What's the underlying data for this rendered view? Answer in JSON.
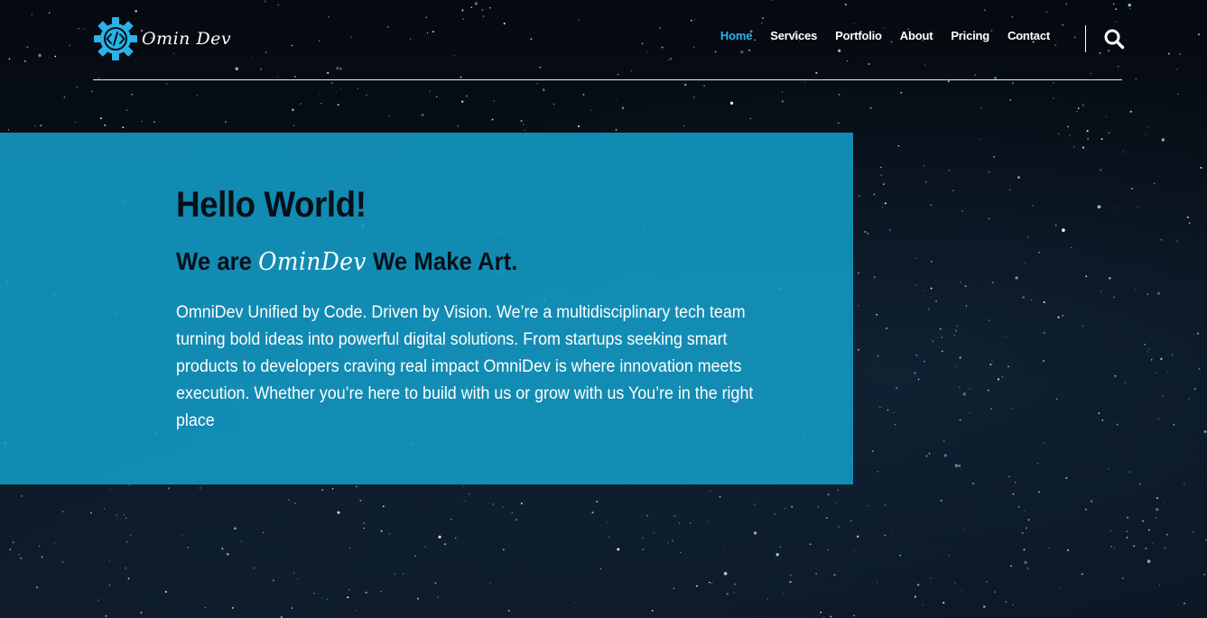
{
  "brand": {
    "logo_text": "Omin Dev",
    "logo_icon": "gear-code-icon",
    "accent_color": "#29b3e8"
  },
  "nav": {
    "items": [
      {
        "label": "Home",
        "active": true
      },
      {
        "label": "Services",
        "active": false
      },
      {
        "label": "Portfolio",
        "active": false
      },
      {
        "label": "About",
        "active": false
      },
      {
        "label": "Pricing",
        "active": false
      },
      {
        "label": "Contact",
        "active": false
      }
    ],
    "search_icon": "search-icon"
  },
  "hero": {
    "title": "Hello World!",
    "subtitle_prefix": "We are",
    "subtitle_brand": "OminDev",
    "subtitle_suffix": "We Make Art.",
    "description": "OmniDev Unified by Code. Driven by Vision. We’re a multidisciplinary tech team turning bold ideas into powerful digital solutions. From startups seeking smart products to developers craving real impact OmniDev is where innovation meets execution. Whether you’re here to build with us or grow with us You’re in the right place",
    "panel_color": "#1394be"
  }
}
